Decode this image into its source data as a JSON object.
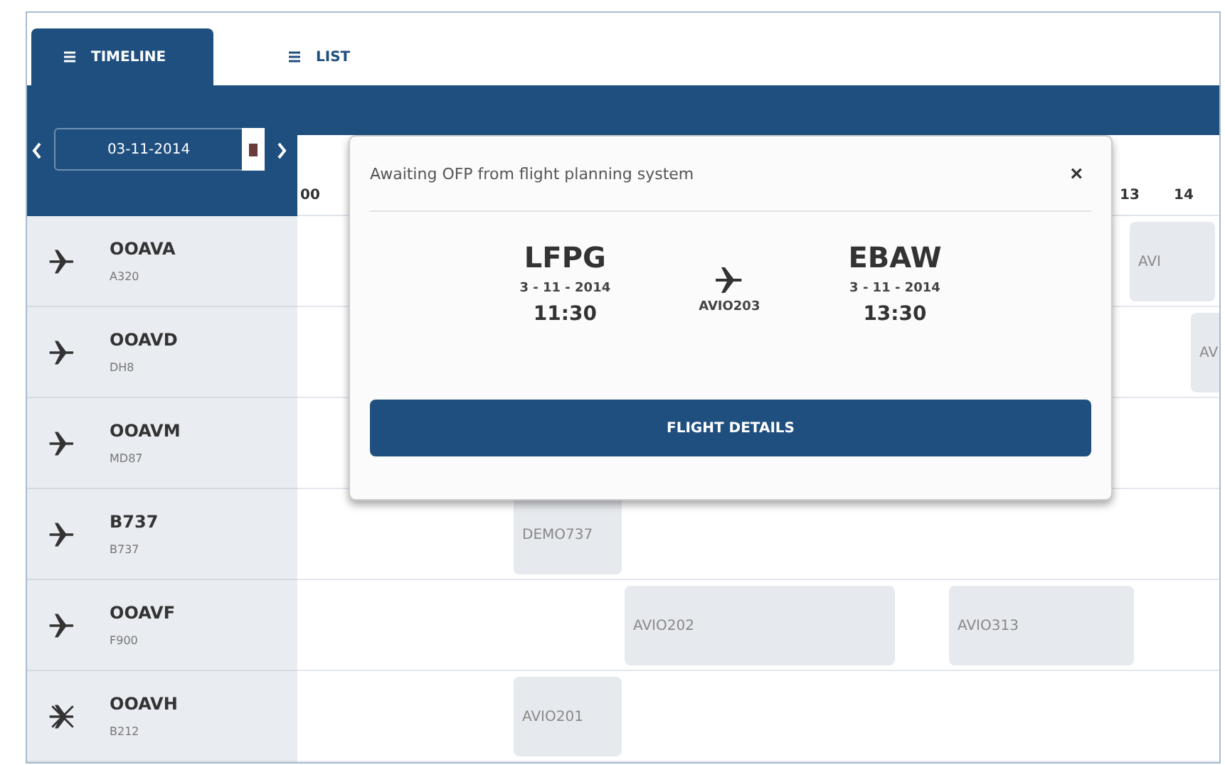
{
  "tabs": [
    {
      "label": "TIMELINE",
      "selected": true
    },
    {
      "label": "LIST",
      "selected": false
    }
  ],
  "date_picker": {
    "value": "03-11-2014"
  },
  "hours": [
    "00",
    "13",
    "14"
  ],
  "aircraft": [
    {
      "registration": "OOAVA",
      "type": "A320",
      "kind": "normal",
      "flights": [
        {
          "label": "AVI"
        }
      ]
    },
    {
      "registration": "OOAVD",
      "type": "DH8",
      "kind": "normal",
      "flights": [
        {
          "label": "AV"
        }
      ]
    },
    {
      "registration": "OOAVM",
      "type": "MD87",
      "kind": "normal"
    },
    {
      "registration": "B737",
      "type": "B737",
      "kind": "normal",
      "flights": [
        {
          "label": "DEMO737"
        }
      ]
    },
    {
      "registration": "OOAVF",
      "type": "F900",
      "kind": "normal",
      "flights": [
        {
          "label": "AVIO202"
        },
        {
          "label": "AVIO313"
        }
      ]
    },
    {
      "registration": "OOAVH",
      "type": "B212",
      "kind": "rotor",
      "flights": [
        {
          "label": "AVIO201"
        }
      ]
    }
  ],
  "popup": {
    "title": "Awaiting OFP from flight planning system",
    "close": "×",
    "departure": {
      "airport": "LFPG",
      "date": "3 - 11 - 2014",
      "time": "11:30"
    },
    "flight": "AVIO203",
    "arrival": {
      "airport": "EBAW",
      "date": "3 - 11 - 2014",
      "time": "13:30"
    },
    "button": "FLIGHT DETAILS"
  }
}
